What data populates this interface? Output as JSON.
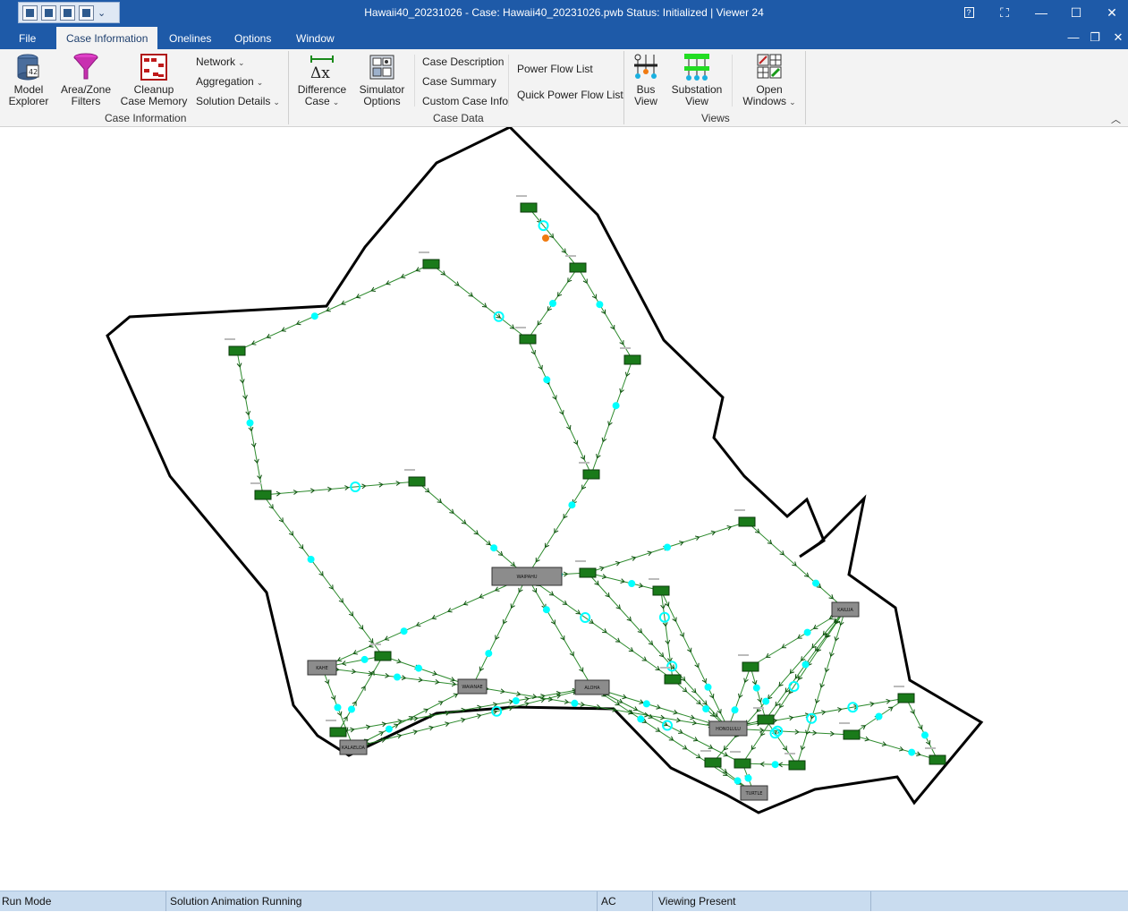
{
  "window": {
    "title": "Hawaii40_20231026 - Case: Hawaii40_20231026.pwb  Status: Initialized | Viewer 24",
    "qat_dropdown": "⌄",
    "controls": {
      "help": "?",
      "min": "—",
      "max": "☐",
      "close": "✕"
    },
    "mdi": {
      "min": "—",
      "restore": "❐",
      "close": "✕"
    }
  },
  "menu": {
    "tabs": [
      "File",
      "Case Information",
      "Onelines",
      "Options",
      "Window"
    ],
    "active": "Case Information"
  },
  "ribbon": {
    "model_explorer": [
      "Model",
      "Explorer"
    ],
    "area_zone": [
      "Area/Zone",
      "Filters"
    ],
    "cleanup": [
      "Cleanup",
      "Case Memory"
    ],
    "network": "Network",
    "aggregation": "Aggregation",
    "solution_details": "Solution Details",
    "group_case_information": "Case Information",
    "difference_case": [
      "Difference",
      "Case"
    ],
    "simulator_options": [
      "Simulator",
      "Options"
    ],
    "case_description": "Case Description",
    "case_summary": "Case Summary",
    "custom_case_info": "Custom Case Info",
    "power_flow_list": "Power Flow List",
    "quick_power_flow_list": "Quick Power Flow List",
    "group_case_data": "Case Data",
    "bus_view": [
      "Bus",
      "View"
    ],
    "substation_view": [
      "Substation",
      "View"
    ],
    "open_windows": [
      "Open",
      "Windows"
    ],
    "group_views": "Views"
  },
  "oneline": {
    "colors": {
      "outline": "#000000",
      "bus": "#1a7a1a",
      "line": "#2e8b2e",
      "flow": "#00ffff",
      "sub": "#8c8c8c"
    },
    "substation_labels": [
      "WAIPAHU",
      "KAHE",
      "KALAELOA",
      "HONOLULU",
      "KAILUA",
      "ALOHA",
      "TURTLE",
      "WAIANAE"
    ]
  },
  "status": {
    "mode": "Run Mode",
    "animation": "Solution Animation Running",
    "ac": "AC",
    "viewing": "Viewing Present"
  }
}
